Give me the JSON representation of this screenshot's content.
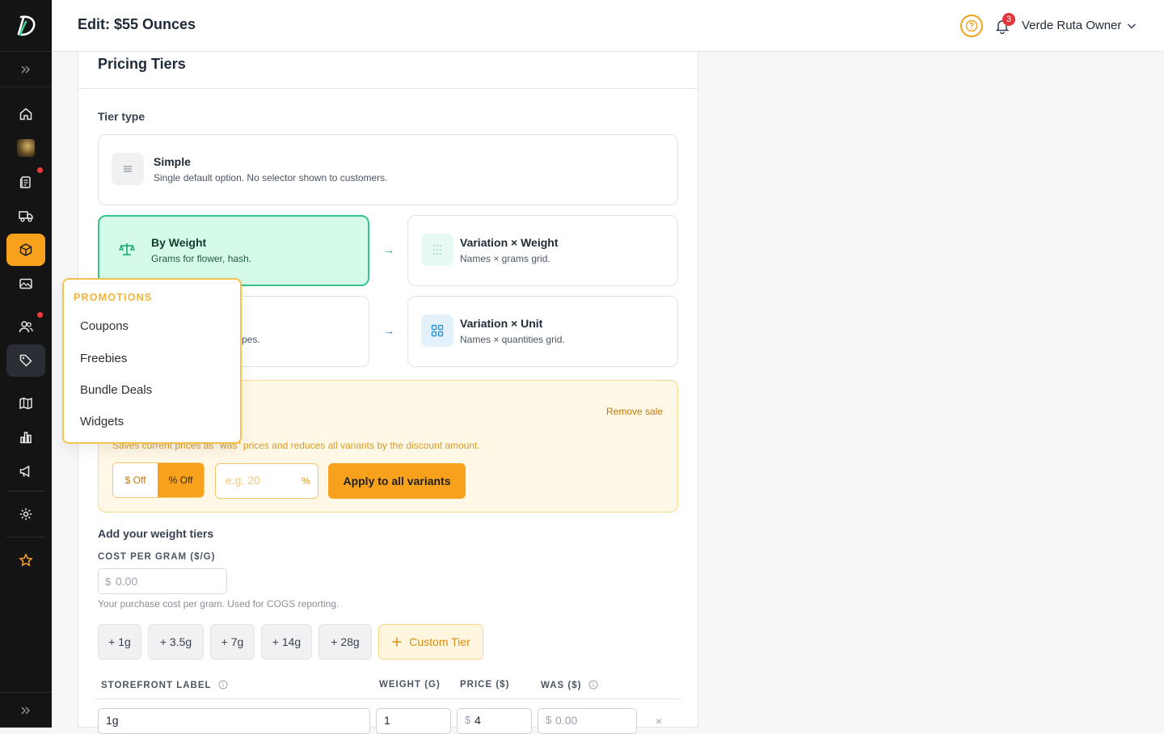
{
  "header": {
    "title": "Edit: $55 Ounces",
    "notifications_count": "3",
    "user_name": "Verde Ruta Owner"
  },
  "sidebar": {
    "items": [
      {
        "icon": "home-icon"
      },
      {
        "icon": "store-avatar"
      },
      {
        "icon": "orders-icon",
        "has_dot": true
      },
      {
        "icon": "delivery-truck-icon"
      },
      {
        "icon": "products-box-icon",
        "active": true
      },
      {
        "icon": "media-icon"
      },
      {
        "icon": "customers-icon",
        "has_dot": true
      },
      {
        "icon": "promotions-tag-icon",
        "hover": true
      },
      {
        "icon": "map-icon"
      },
      {
        "icon": "analytics-icon"
      },
      {
        "icon": "marketing-megaphone-icon"
      },
      {
        "icon": "settings-gear-icon"
      },
      {
        "icon": "star-icon"
      }
    ]
  },
  "card": {
    "title": "Pricing Tiers",
    "tier_type_label": "Tier type",
    "options": {
      "simple": {
        "title": "Simple",
        "desc": "Single default option. No selector shown to customers."
      },
      "by_weight": {
        "title": "By Weight",
        "desc": "Grams for flower, hash."
      },
      "variation_weight": {
        "title": "Variation × Weight",
        "desc": "Names × grams grid."
      },
      "by_unit": {
        "desc": "pes."
      },
      "variation_unit": {
        "title": "Variation × Unit",
        "desc": "Names × quantities grid."
      }
    },
    "arrow": "→",
    "sale": {
      "remove_label": "Remove sale",
      "desc": "Saves current prices as \"was\" prices and reduces all variants by the discount amount.",
      "dollar_off": "$ Off",
      "percent_off": "% Off",
      "percent_placeholder": "e.g. 20",
      "percent_sign": "%",
      "apply_label": "Apply to all variants"
    },
    "weight_tiers": {
      "title": "Add your weight tiers",
      "cost_label": "COST PER GRAM ($/G)",
      "currency": "$",
      "cost_placeholder": "0.00",
      "cost_hint": "Your purchase cost per gram. Used for COGS reporting.",
      "chips": [
        "+ 1g",
        "+ 3.5g",
        "+ 7g",
        "+ 14g",
        "+ 28g"
      ],
      "custom_tier_label": "Custom Tier"
    },
    "table": {
      "headers": {
        "label": "STOREFRONT LABEL",
        "weight": "WEIGHT (G)",
        "price": "PRICE ($)",
        "was": "WAS ($)"
      },
      "rows": [
        {
          "label": "1g",
          "weight": "1",
          "price": "4",
          "was": "0.00"
        }
      ],
      "delete_glyph": "×"
    }
  },
  "promotions_menu": {
    "heading": "PROMOTIONS",
    "items": [
      "Coupons",
      "Freebies",
      "Bundle Deals",
      "Widgets"
    ]
  },
  "colors": {
    "accent": "#f8a11c",
    "selected_green": "#35c58a",
    "sidebar_bg": "#141414"
  }
}
